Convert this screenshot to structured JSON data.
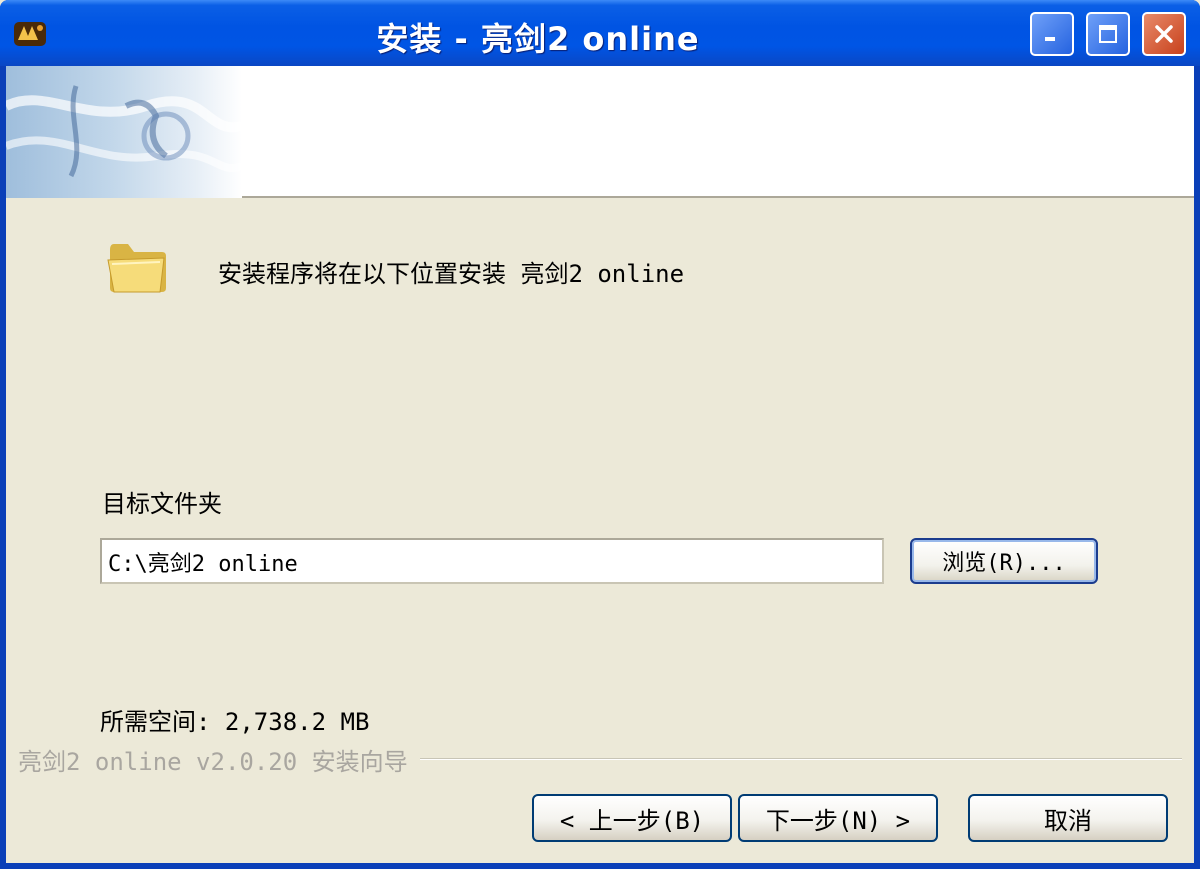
{
  "window": {
    "title": "安装 - 亮剑2 online",
    "icon": "app-logo-icon",
    "controls": {
      "minimize": "minimize-icon",
      "maximize": "maximize-icon",
      "close": "close-icon"
    }
  },
  "header": {
    "banner_icon": "game-banner-image"
  },
  "content": {
    "intro_text": "安装程序将在以下位置安装 亮剑2 online",
    "destination_label": "目标文件夹",
    "destination_path": "C:\\亮剑2 online",
    "browse_label": "浏览(R)...",
    "space_required": "所需空间: 2,738.2 MB"
  },
  "footer": {
    "branding": "亮剑2 online v2.0.20 安装向导",
    "back_label": "< 上一步(B)",
    "next_label": "下一步(N) >",
    "cancel_label": "取消"
  },
  "colors": {
    "titlebar": "#0054e3",
    "background": "#ece9d8",
    "close_button": "#c8411c"
  }
}
